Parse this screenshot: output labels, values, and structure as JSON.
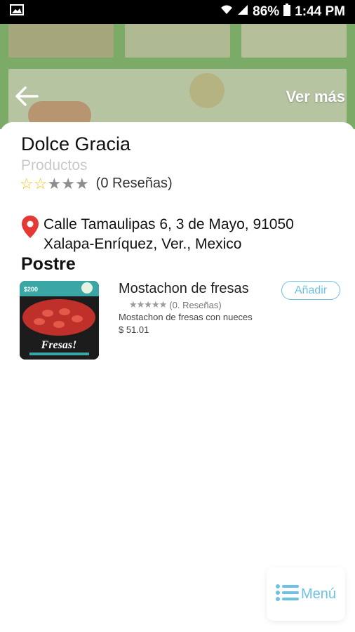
{
  "status_bar": {
    "battery": "86%",
    "time": "1:44 PM"
  },
  "header": {
    "ver_mas": "Ver más"
  },
  "store": {
    "name": "Dolce Gracia",
    "category": "Productos",
    "rating": 2,
    "max_rating": 5,
    "reviews_label": "(0 Reseñas)",
    "address_line1": "Calle Tamaulipas 6, 3 de Mayo, 91050",
    "address_line2": "Xalapa-Enríquez, Ver., Mexico"
  },
  "section": {
    "title": "Postre"
  },
  "products": [
    {
      "name": "Mostachon de fresas",
      "stars": "★★★★★",
      "reviews": "(0. Reseñas)",
      "description": "Mostachon de fresas con nueces",
      "price": "$ 51.01",
      "add_label": "Añadir",
      "image_text_price": "$200",
      "image_text_title": "Fresas!"
    }
  ],
  "menu_button": {
    "label": "Menú"
  },
  "colors": {
    "accent": "#6ec1e4",
    "pin": "#e53935",
    "star_on": "#f5c518",
    "star_off": "#8e8e8e"
  }
}
